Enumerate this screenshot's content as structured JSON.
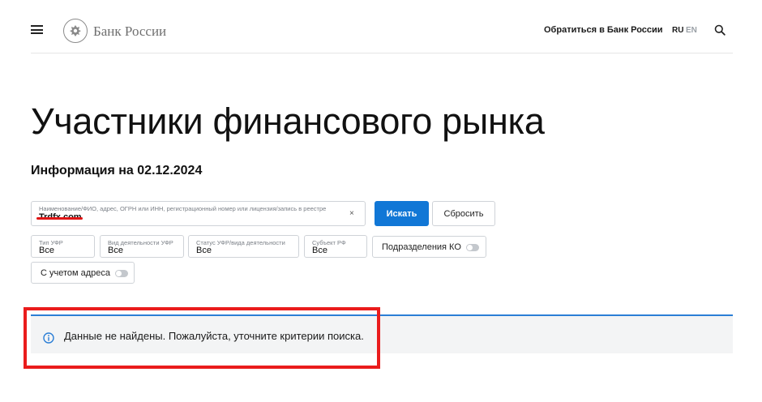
{
  "header": {
    "logo_text": "Банк России",
    "contact_link": "Обратиться в Банк России",
    "lang_ru": "RU",
    "lang_en": "EN"
  },
  "page": {
    "title": "Участники финансового рынка",
    "info_date": "Информация на 02.12.2024"
  },
  "search": {
    "label": "Наименование/ФИО, адрес, ОГРН или ИНН, регистрационный номер или лицензия/запись в реестре",
    "value": "Trdfx.com",
    "clear": "×",
    "search_button": "Искать",
    "reset_button": "Сбросить"
  },
  "filters": {
    "type": {
      "label": "Тип УФР",
      "value": "Все"
    },
    "activity": {
      "label": "Вид деятельности УФР",
      "value": "Все"
    },
    "status": {
      "label": "Статус УФР/вида деятельности",
      "value": "Все"
    },
    "subject": {
      "label": "Субъект РФ",
      "value": "Все"
    },
    "divisions_toggle": "Подразделения КО",
    "address_toggle": "С учетом адреса"
  },
  "alert": {
    "text": "Данные не найдены. Пожалуйста, уточните критерии поиска."
  },
  "colors": {
    "accent": "#1177d6",
    "annotation_red": "#ea1c1c",
    "alert_border": "#2b7ed6"
  }
}
